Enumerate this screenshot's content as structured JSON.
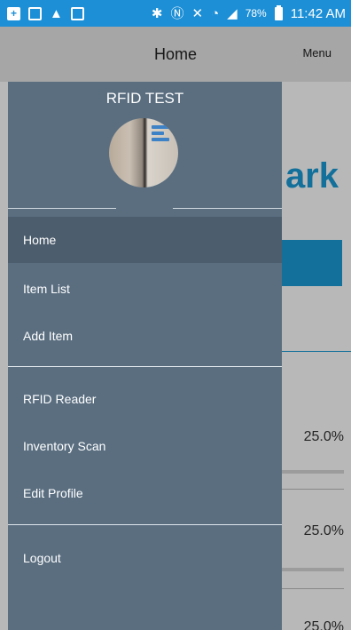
{
  "status_bar": {
    "battery_percent": "78%",
    "time": "11:42 AM"
  },
  "app_bar": {
    "title": "Home",
    "menu_label": "Menu"
  },
  "background_content": {
    "title_fragment": "ark",
    "rows": [
      {
        "percent": "25.0%"
      },
      {
        "percent": "25.0%"
      },
      {
        "percent": "25.0%"
      }
    ]
  },
  "drawer": {
    "title": "RFID TEST",
    "items_group1": [
      {
        "label": "Home",
        "active": true
      },
      {
        "label": "Item List",
        "active": false
      },
      {
        "label": "Add Item",
        "active": false
      }
    ],
    "items_group2": [
      {
        "label": "RFID Reader",
        "active": false
      },
      {
        "label": "Inventory Scan",
        "active": false
      },
      {
        "label": "Edit Profile",
        "active": false
      }
    ],
    "items_group3": [
      {
        "label": "Logout",
        "active": false
      }
    ]
  },
  "colors": {
    "status_bar": "#1d8fd6",
    "drawer_bg": "#5a6e80",
    "drawer_active": "#4c5d6d",
    "accent": "#1b9bd7"
  }
}
